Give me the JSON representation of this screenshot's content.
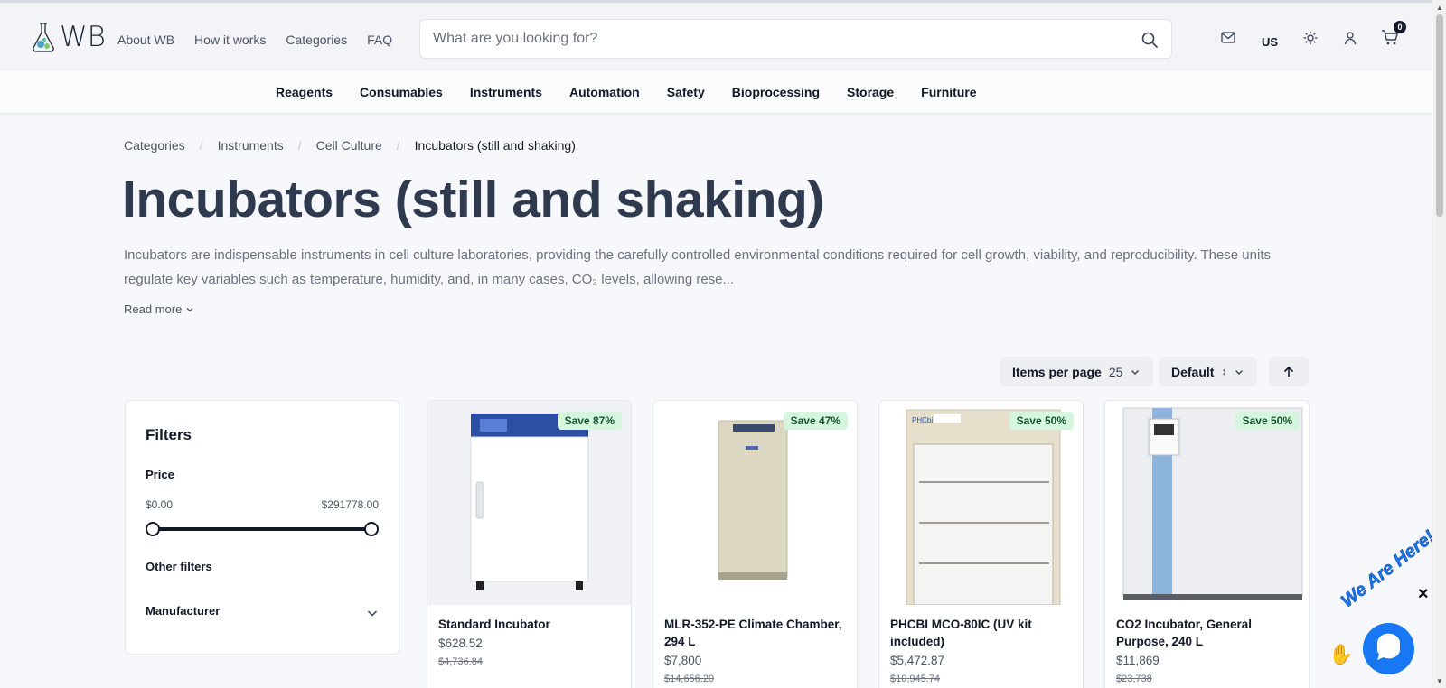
{
  "header": {
    "logo_text": "WB",
    "nav": [
      "About WB",
      "How it works",
      "Categories",
      "FAQ"
    ],
    "search_placeholder": "What are you looking for?",
    "locale": "US",
    "cart_count": "0"
  },
  "categories_nav": [
    "Reagents",
    "Consumables",
    "Instruments",
    "Automation",
    "Safety",
    "Bioprocessing",
    "Storage",
    "Furniture"
  ],
  "breadcrumb": [
    "Categories",
    "Instruments",
    "Cell Culture",
    "Incubators (still and shaking)"
  ],
  "page": {
    "title": "Incubators (still and shaking)",
    "description_1": "Incubators are indispensable instruments in cell culture laboratories, providing the carefully controlled environmental conditions required for cell growth, viability, and reproducibility. These units",
    "description_2": "regulate key variables such as temperature, humidity, and, in many cases, CO₂ levels, allowing rese...",
    "read_more": "Read more"
  },
  "controls": {
    "items_per_page_label": "Items per page",
    "items_per_page_value": "25",
    "sort_label": "Default",
    "sort_indicator": "↕"
  },
  "filters": {
    "title": "Filters",
    "price_label": "Price",
    "price_min": "$0.00",
    "price_max": "$291778.00",
    "other_label": "Other filters",
    "manufacturer_label": "Manufacturer"
  },
  "products": [
    {
      "name": "Standard Incubator",
      "price": "$628.52",
      "old_price": "$4,736.84",
      "badge": "Save 87%"
    },
    {
      "name": "MLR-352-PE Climate Chamber, 294 L",
      "price": "$7,800",
      "old_price": "$14,656.20",
      "badge": "Save 47%"
    },
    {
      "name": "PHCBI MCO-80IC (UV kit included)",
      "price": "$5,472.87",
      "old_price": "$10,945.74",
      "badge": "Save 50%"
    },
    {
      "name": "CO2 Incubator, General Purpose, 240 L",
      "price": "$11,869",
      "old_price": "$23,738",
      "badge": "Save 50%"
    }
  ],
  "chat": {
    "label": "We Are Here!",
    "close": "✕"
  },
  "colors": {
    "accent": "#1877f2",
    "badge_bg": "#d6f5df",
    "title": "#2f3a4f"
  }
}
